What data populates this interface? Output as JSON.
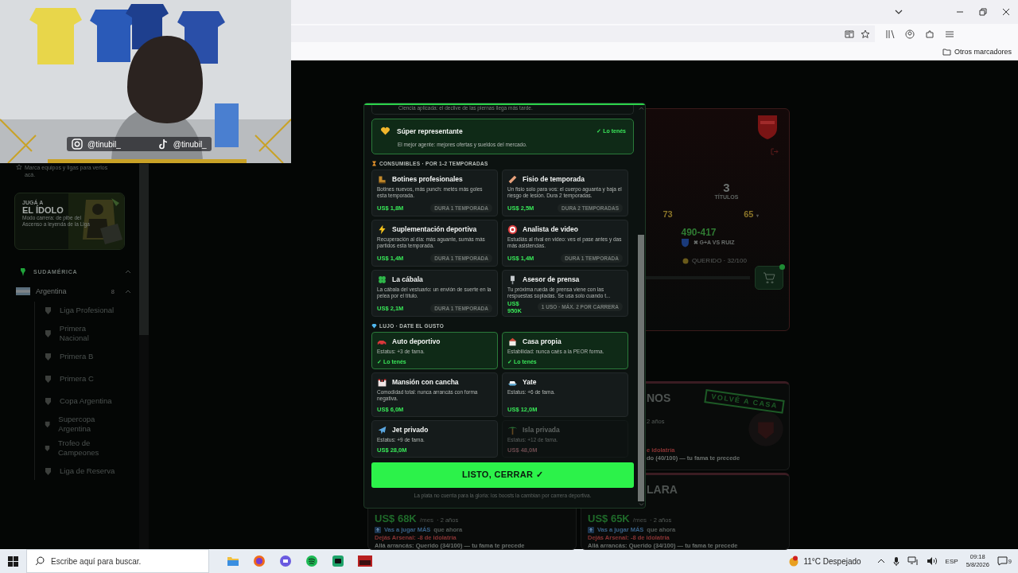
{
  "browser": {
    "bookmarks": "Otros marcadores"
  },
  "stream_overlay": {
    "handles": [
      {
        "kind": "instagram",
        "text": "@tinubil_"
      },
      {
        "kind": "tiktok",
        "text": "@tinubil_"
      }
    ]
  },
  "sidebar": {
    "hint": "Marca equipos y ligas para verlos acá.",
    "promo": {
      "kicker": "JUGÁ A",
      "title": "EL ÍDOLO",
      "text": "Modo carrera: de pibe del Ascenso a leyenda de la Liga"
    },
    "region": {
      "label": "SUDAMÉRICA",
      "expanded": true
    },
    "country": {
      "label": "Argentina",
      "count": "8",
      "expanded": true
    },
    "leagues": [
      "Liga Profesional",
      "Primera Nacional",
      "Primera B",
      "Primera C",
      "Copa Argentina",
      "Supercopa Argentina",
      "Trofeo de Campeones",
      "Liga de Reserva"
    ]
  },
  "club_card": {
    "titles": "3",
    "titles_label": "TÍTULOS",
    "stat_1": "73",
    "stat_2": "65",
    "stat_2_mark": "▾",
    "score": "490-417",
    "versus": "✖ G+A VS RUIZ",
    "fame": "QUERIDO · 32/100"
  },
  "offers": [
    {
      "title": "NOS",
      "duration": "2 años",
      "penalty": "e idolatría",
      "start": "do (40/100) — tu fama te precede",
      "stamp": "VOLVÉ A CASA"
    },
    {
      "salary": "US$ 68K",
      "period": "/mes",
      "duration": "· 2 años",
      "perk": "Vas a jugar MÁS",
      "perk_note": "que ahora",
      "penalty": "Dejás Arsenal: -8 de idolatría",
      "start": "Allá arrancás: Querido (34/100) — tu fama te precede"
    },
    {
      "title": "LARA",
      "salary": "US$ 65K",
      "period": "/mes",
      "duration": "· 2 años",
      "perk": "Vas a jugar MÁS",
      "perk_note": "que ahora",
      "penalty": "Dejás Arsenal: -8 de idolatría",
      "start": "Allá arrancás: Querido (34/100) — tu fama te precede"
    }
  ],
  "shop_modal": {
    "clipped_line": "Ciencia aplicada: el declive de las piernas llega más tarde.",
    "featured": {
      "name": "Súper representante",
      "description": "El mejor agente: mejores ofertas y sueldos del mercado.",
      "status": "✓ Lo tenés",
      "owned": true
    },
    "sections": [
      {
        "title": "CONSUMIBLES · POR 1-2 TEMPORADAS",
        "items": [
          {
            "name": "Botines profesionales",
            "description": "Botines nuevos, más punch: metés más goles esta temporada.",
            "price": "US$ 1,8M",
            "tag": "DURA 1 TEMPORADA"
          },
          {
            "name": "Fisio de temporada",
            "description": "Un fisio solo para vos: el cuerpo aguanta y baja el riesgo de lesión. Dura 2 temporadas.",
            "price": "US$ 2,5M",
            "tag": "DURA 2 TEMPORADAS"
          },
          {
            "name": "Suplementación deportiva",
            "description": "Recuperación al día: más aguante, sumás más partidos esta temporada.",
            "price": "US$ 1,4M",
            "tag": "DURA 1 TEMPORADA"
          },
          {
            "name": "Analista de video",
            "description": "Estudiás al rival en video: ves el pase antes y das más asistencias.",
            "price": "US$ 1,4M",
            "tag": "DURA 1 TEMPORADA"
          },
          {
            "name": "La cábala",
            "description": "La cábala del vestuario: un envión de suerte en la pelea por el título.",
            "price": "US$ 2,1M",
            "tag": "DURA 1 TEMPORADA"
          },
          {
            "name": "Asesor de prensa",
            "description": "Tu próxima rueda de prensa viene con las respuestas sopladas. Se usa solo cuando t...",
            "price": "US$ 950K",
            "tag": "1 USO · MÁX. 2 POR CARRERA"
          }
        ]
      },
      {
        "title": "LUJO · DATE EL GUSTO",
        "items": [
          {
            "name": "Auto deportivo",
            "description": "Estatus: +3 de fama.",
            "owned": true,
            "status": "✓ Lo tenés",
            "affordable": true
          },
          {
            "name": "Casa propia",
            "description": "Estabilidad: nunca caés a la PEOR forma.",
            "owned": true,
            "status": "✓ Lo tenés",
            "affordable": true
          },
          {
            "name": "Mansión con cancha",
            "description": "Comodidad total: nunca arrancás con forma negativa.",
            "owned": false,
            "price": "US$ 6,0M",
            "affordable": true
          },
          {
            "name": "Yate",
            "description": "Estatus: +6 de fama.",
            "owned": false,
            "price": "US$ 12,0M",
            "affordable": true
          },
          {
            "name": "Jet privado",
            "description": "Estatus: +9 de fama.",
            "owned": false,
            "price": "US$ 28,0M",
            "affordable": true
          },
          {
            "name": "Isla privada",
            "description": "Estatus: +12 de fama.",
            "owned": false,
            "price": "US$ 48,0M",
            "affordable": false
          }
        ]
      }
    ],
    "close_button": "LISTO, CERRAR ✓",
    "footer": "La plata no cuenta para la gloria: los boosts la cambian por carrera deportiva."
  },
  "taskbar": {
    "search_placeholder": "Escribe aquí para buscar.",
    "weather": "11°C Despejado",
    "language": "ESP",
    "time": "09:18",
    "date": "5/8/2026",
    "notifications": "9"
  }
}
